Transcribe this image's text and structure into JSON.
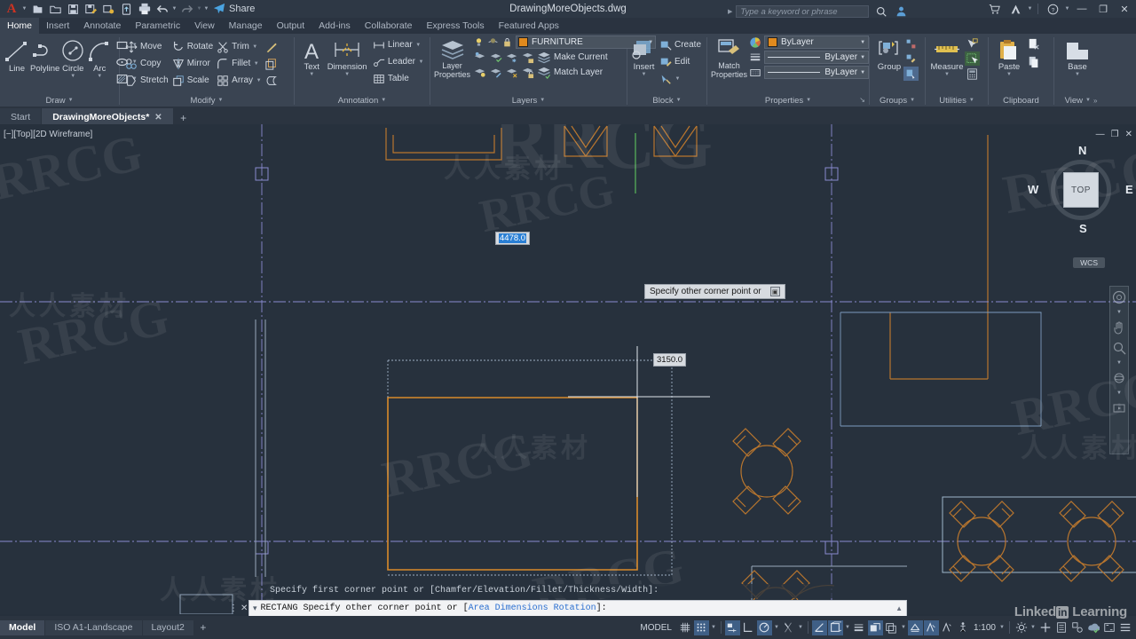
{
  "titlebar": {
    "document_title": "DrawingMoreObjects.dwg",
    "search_placeholder": "Type a keyword or phrase",
    "share_label": "Share",
    "quick_access": [
      "new-icon",
      "open-icon",
      "save-icon",
      "saveas-icon",
      "plot-preview-icon",
      "export-icon",
      "print-icon",
      "undo-icon",
      "redo-icon",
      "customize-icon"
    ],
    "window_buttons": [
      "minimize",
      "restore",
      "close"
    ]
  },
  "ribbon_tabs": [
    {
      "label": "Home",
      "active": true
    },
    {
      "label": "Insert",
      "active": false
    },
    {
      "label": "Annotate",
      "active": false
    },
    {
      "label": "Parametric",
      "active": false
    },
    {
      "label": "View",
      "active": false
    },
    {
      "label": "Manage",
      "active": false
    },
    {
      "label": "Output",
      "active": false
    },
    {
      "label": "Add-ins",
      "active": false
    },
    {
      "label": "Collaborate",
      "active": false
    },
    {
      "label": "Express Tools",
      "active": false
    },
    {
      "label": "Featured Apps",
      "active": false
    }
  ],
  "ribbon": {
    "draw": {
      "title": "Draw",
      "buttons": [
        "Line",
        "Polyline",
        "Circle",
        "Arc"
      ],
      "small": [
        "rectangle-icon",
        "ellipse-icon",
        "hatch-icon"
      ]
    },
    "modify": {
      "title": "Modify",
      "col1": [
        "Move",
        "Copy",
        "Stretch"
      ],
      "col2": [
        "Rotate",
        "Mirror",
        "Scale"
      ],
      "col3": [
        "Trim",
        "Fillet",
        "Array"
      ],
      "col4": [
        "explode-icon",
        "offset-icon",
        "join-icon"
      ]
    },
    "annotation": {
      "title": "Annotation",
      "big": [
        "Text",
        "Dimension"
      ],
      "small": [
        "Linear",
        "Leader",
        "Table"
      ]
    },
    "layers": {
      "title": "Layers",
      "big": "Layer\nProperties",
      "current_layer": "FURNITURE",
      "rows": [
        "Make Current",
        "Match Layer"
      ]
    },
    "block": {
      "title": "Block",
      "big": "Insert",
      "small": [
        "Create",
        "Edit"
      ]
    },
    "properties": {
      "title": "Properties",
      "big": "Match\nProperties",
      "color": "ByLayer",
      "linetype": "ByLayer",
      "lineweight": "ByLayer"
    },
    "groups": {
      "title": "Groups",
      "big": "Group"
    },
    "utilities": {
      "title": "Utilities",
      "big": "Measure"
    },
    "clipboard": {
      "title": "Clipboard",
      "big": "Paste"
    },
    "view": {
      "title": "View",
      "big": "Base"
    }
  },
  "file_tabs": [
    {
      "label": "Start",
      "active": false
    },
    {
      "label": "DrawingMoreObjects*",
      "active": true
    }
  ],
  "viewport": {
    "label": "[−][Top][2D Wireframe]",
    "viewcube": {
      "face": "TOP",
      "n": "N",
      "s": "S",
      "e": "E",
      "w": "W"
    },
    "ucs_label": "WCS"
  },
  "dynamic_input": {
    "dimension_x": "4478.0",
    "dimension_y": "3150.0",
    "prompt": "Specify other corner point or"
  },
  "command": {
    "history": "Specify first corner point or [Chamfer/Elevation/Fillet/Thickness/Width]:",
    "active_command": "RECTANG Specify other corner point or [",
    "active_options": "Area Dimensions Rotation",
    "active_tail": "]:"
  },
  "statusbar": {
    "layout_tabs": [
      {
        "label": "Model",
        "active": true
      },
      {
        "label": "ISO A1-Landscape",
        "active": false
      },
      {
        "label": "Layout2",
        "active": false
      }
    ],
    "space_label": "MODEL",
    "scale": "1:100",
    "toggles": [
      {
        "name": "grid-display",
        "on": false
      },
      {
        "name": "snap-mode",
        "on": true
      },
      {
        "name": "infer-constraints",
        "on": true
      },
      {
        "name": "ortho-mode",
        "on": false
      },
      {
        "name": "polar-tracking",
        "on": true
      },
      {
        "name": "object-snap-tracking",
        "on": false
      },
      {
        "name": "object-snap",
        "on": true
      },
      {
        "name": "dynamic-ucs",
        "on": false
      },
      {
        "name": "lineweight",
        "on": false
      },
      {
        "name": "transparency",
        "on": true
      },
      {
        "name": "selection-cycling",
        "on": false
      },
      {
        "name": "3d-object-snap",
        "on": true
      },
      {
        "name": "annotation-visibility",
        "on": true
      },
      {
        "name": "autoscale",
        "on": false
      },
      {
        "name": "annotation-scale",
        "on": false
      }
    ]
  },
  "watermarks": {
    "rrcg": "RRCG",
    "cjk": "人人素材",
    "brand": "Linked",
    "brand2": "Learning",
    "brand_in": "in"
  }
}
